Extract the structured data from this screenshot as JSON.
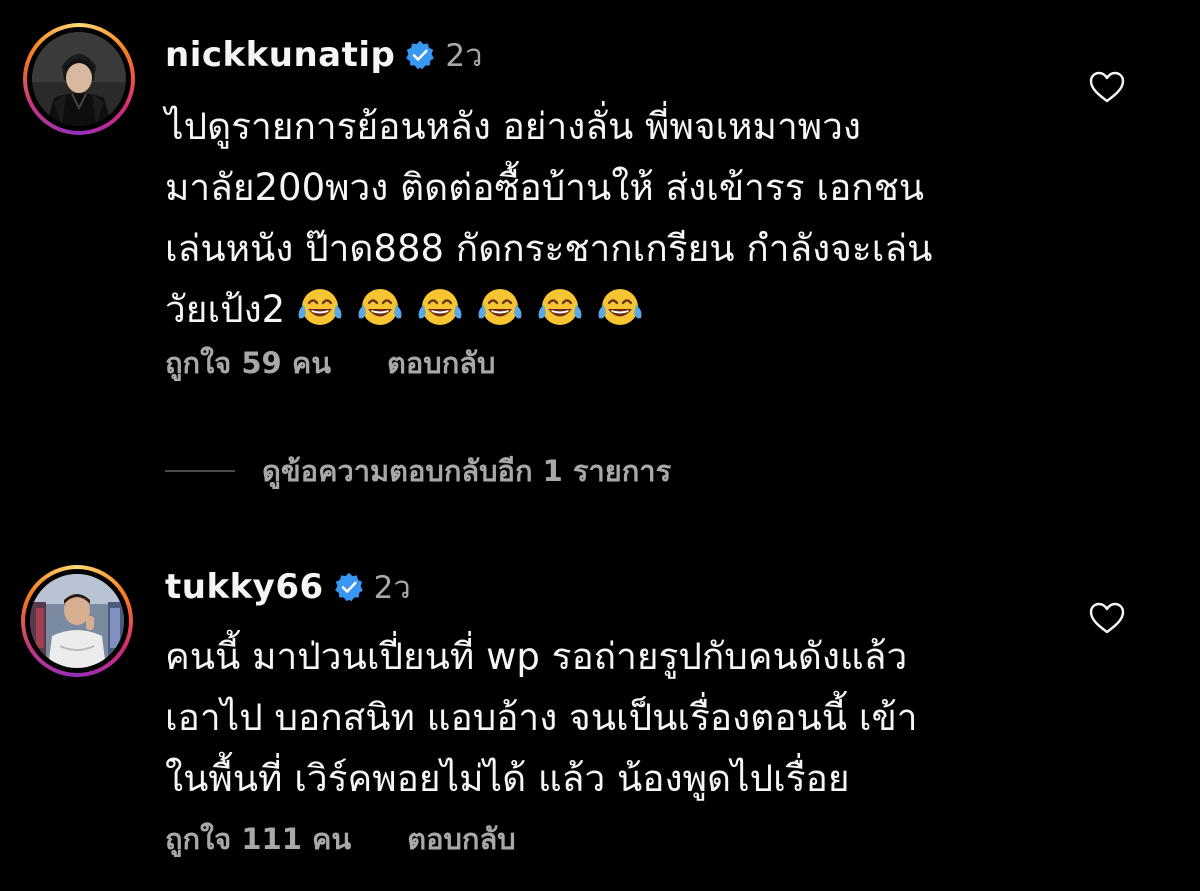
{
  "comments": [
    {
      "username": "nickkunatip",
      "time": "2ว",
      "lines": [
        "ไปดูรายการย้อนหลัง อย่างลั่น พี่พจเหมาพวง",
        "มาลัย200พวง ติดต่อซื้อบ้านให้ ส่งเข้ารร เอกชน",
        "เล่นหนัง ป๊าด888 กัดกระชากเกรียน กำลังจะเล่น",
        "วัยเป้ง2"
      ],
      "emojis": [
        "😂",
        "😂",
        "😂",
        "😂",
        "😂",
        "😂"
      ],
      "likes": "ถูกใจ 59 คน",
      "reply": "ตอบกลับ"
    },
    {
      "username": "tukky66",
      "time": "2ว",
      "lines": [
        "คนนี้ มาป่วนเปี่ยนที่ wp รอถ่ายรูปกับคนดังแล้ว",
        "เอาไป บอกสนิท แอบอ้าง จนเป็นเรื่องตอนนี้ เข้า",
        "ในพื้นที่ เวิร์คพอยไม่ได้ แล้ว น้องพูดไปเรื่อย"
      ],
      "likes": "ถูกใจ 111 คน",
      "reply": "ตอบกลับ"
    }
  ],
  "view_replies": "ดูข้อความตอบกลับอีก 1 รายการ",
  "icons": {
    "verified": "verified-badge-icon",
    "heart": "heart-outline-icon",
    "emoji": "face-with-tears-of-joy-emoji"
  },
  "colors": {
    "background": "#000000",
    "text": "#f5f5f5",
    "secondary": "#a8a8a8",
    "verified": "#3897f0"
  }
}
